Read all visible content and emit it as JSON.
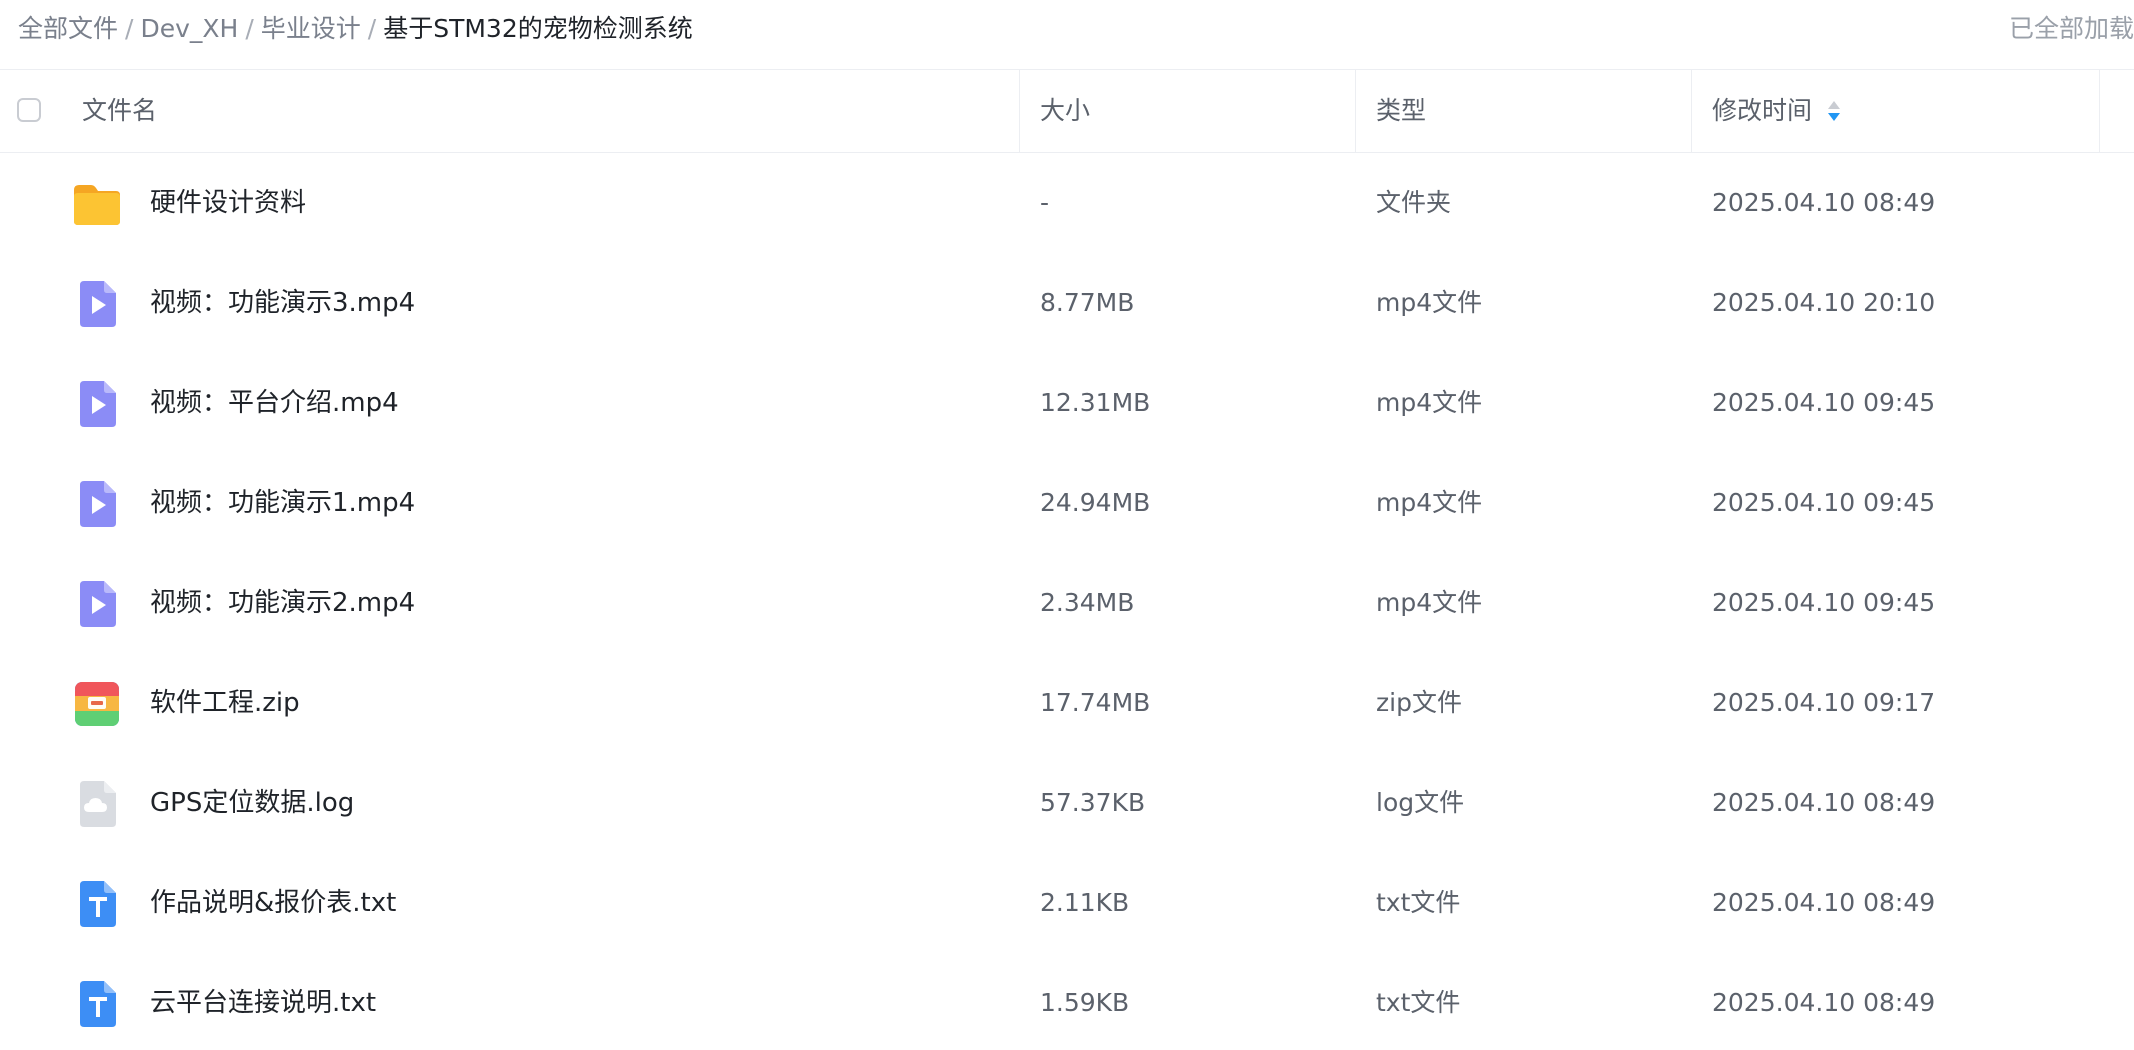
{
  "breadcrumb": {
    "items": [
      "全部文件",
      "Dev_XH",
      "毕业设计"
    ],
    "separator": "/",
    "current": "基于STM32的宠物检测系统"
  },
  "status": {
    "loaded_all": "已全部加载"
  },
  "table": {
    "headers": {
      "name": "文件名",
      "size": "大小",
      "type": "类型",
      "modified": "修改时间"
    },
    "sort": {
      "column": "modified",
      "direction": "descending",
      "active_color": "#2196f3"
    },
    "rows": [
      {
        "icon": "folder-icon",
        "name": "硬件设计资料",
        "size": "-",
        "type": "文件夹",
        "modified": "2025.04.10 08:49"
      },
      {
        "icon": "video-file-icon",
        "name": "视频：功能演示3.mp4",
        "size": "8.77MB",
        "type": "mp4文件",
        "modified": "2025.04.10 20:10"
      },
      {
        "icon": "video-file-icon",
        "name": "视频：平台介绍.mp4",
        "size": "12.31MB",
        "type": "mp4文件",
        "modified": "2025.04.10 09:45"
      },
      {
        "icon": "video-file-icon",
        "name": "视频：功能演示1.mp4",
        "size": "24.94MB",
        "type": "mp4文件",
        "modified": "2025.04.10 09:45"
      },
      {
        "icon": "video-file-icon",
        "name": "视频：功能演示2.mp4",
        "size": "2.34MB",
        "type": "mp4文件",
        "modified": "2025.04.10 09:45"
      },
      {
        "icon": "zip-file-icon",
        "name": "软件工程.zip",
        "size": "17.74MB",
        "type": "zip文件",
        "modified": "2025.04.10 09:17"
      },
      {
        "icon": "cloud-file-icon",
        "name": "GPS定位数据.log",
        "size": "57.37KB",
        "type": "log文件",
        "modified": "2025.04.10 08:49"
      },
      {
        "icon": "text-file-icon",
        "name": "作品说明&报价表.txt",
        "size": "2.11KB",
        "type": "txt文件",
        "modified": "2025.04.10 08:49"
      },
      {
        "icon": "text-file-icon",
        "name": "云平台连接说明.txt",
        "size": "1.59KB",
        "type": "txt文件",
        "modified": "2025.04.10 08:49"
      }
    ]
  },
  "colors": {
    "folder": "#fcbf30",
    "video": "#8b8cf6",
    "text_file": "#3d8ef5",
    "cloud_file": "#d6d9de",
    "zip_top": "#f0565b",
    "zip_mid": "#f7b742",
    "zip_bottom": "#5fcf74",
    "zip_side": "#4aa3f0"
  }
}
